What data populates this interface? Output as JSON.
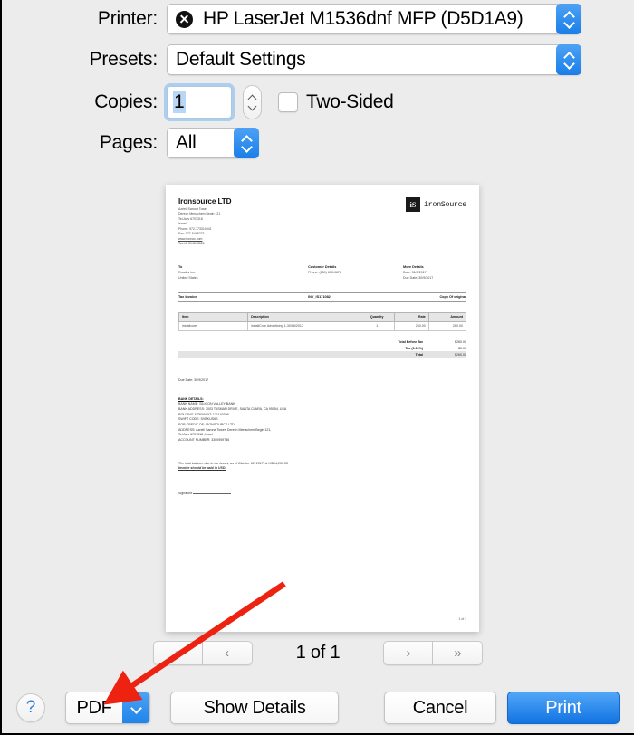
{
  "dialog": {
    "printer": {
      "label": "Printer:",
      "value": "HP LaserJet M1536dnf MFP (D5D1A9)",
      "status_icon": "error-x-icon"
    },
    "presets": {
      "label": "Presets:",
      "value": "Default Settings"
    },
    "copies": {
      "label": "Copies:",
      "value": "1"
    },
    "two_sided": {
      "label": "Two-Sided",
      "checked": false
    },
    "pages": {
      "label": "Pages:",
      "value": "All"
    }
  },
  "pager": {
    "first_icon": "«",
    "prev_icon": "‹",
    "next_icon": "›",
    "last_icon": "»",
    "text": "1 of 1"
  },
  "footer": {
    "help_label": "?",
    "pdf_label": "PDF",
    "pdf_arrow_icon": "chevron-down-icon",
    "show_details_label": "Show Details",
    "cancel_label": "Cancel",
    "print_label": "Print"
  },
  "preview": {
    "company": {
      "name": "Ironsource LTD",
      "lines": [
        "Azrieli Sarona Tower",
        "Derech Menachem Begin 121",
        "Tel-Aviv 6701318",
        "Israel",
        "Phone: 972-773310041",
        "Fax: 077-5448273"
      ],
      "website": "www.ironsrc.com",
      "tax_id": "Tax id: 514643626"
    },
    "logo": {
      "mark": "iS",
      "word": "ironSource"
    },
    "to": {
      "title": "To",
      "lines": [
        "Roadits Inc.",
        "United States"
      ]
    },
    "customer_details": {
      "title": "Customer Details",
      "lines": [
        "Phone: (650) 603-0878"
      ]
    },
    "more_details": {
      "title": "More Details",
      "lines": [
        "Date: 31/8/2017",
        "Due Date: 30/9/2017"
      ]
    },
    "invoice_bar": {
      "left": "Tax Invoice",
      "center": "INV_IS171082",
      "right": "Copy Of original"
    },
    "table": {
      "headers": [
        "Item",
        "Description",
        "Quantity",
        "Rate",
        "Amount"
      ],
      "rows": [
        [
          "installcore",
          "installCore Advertising 1-30/06/2017",
          "1",
          "260.00",
          "260.00"
        ]
      ]
    },
    "totals": [
      {
        "label": "Total Before Tax",
        "value": "$260.00"
      },
      {
        "label": "Tax (0.00%)",
        "value": "$0.00"
      },
      {
        "label": "Total",
        "value": "$260.00"
      }
    ],
    "due_date": "Due Date: 30/9/2017",
    "bank": {
      "heading": "BANK DETAILS:",
      "lines": [
        "BANK NAME: SILICON VALLEY BANK",
        "BANK ADDRESS: 3003 TASMAN DRIVE, SANTA CLARA, CA 95054, USA",
        "ROUTING & TRANSIT: 121140399",
        "SWIFT CODE: SVBKUS6S",
        "FOR CREDIT OF: IRONSOURCE LTD",
        "ADDRESS: Azrieli Sarona Tower, Derech Menachem Begin 121,",
        "Tel Aviv 6701318 ,Israel",
        "ACCOUNT NUMBER: 3300959736"
      ]
    },
    "balance_note": "The total balance due in our books, as of Oktober 02, 2017, is USD4,293.35",
    "balance_emphasis": "Invoice should be paid in USD.",
    "signature_label": "Signature",
    "page_footer": "1 of 1"
  },
  "annotation": {
    "arrow_color": "#ee2211",
    "points_to": "pdf-button"
  }
}
